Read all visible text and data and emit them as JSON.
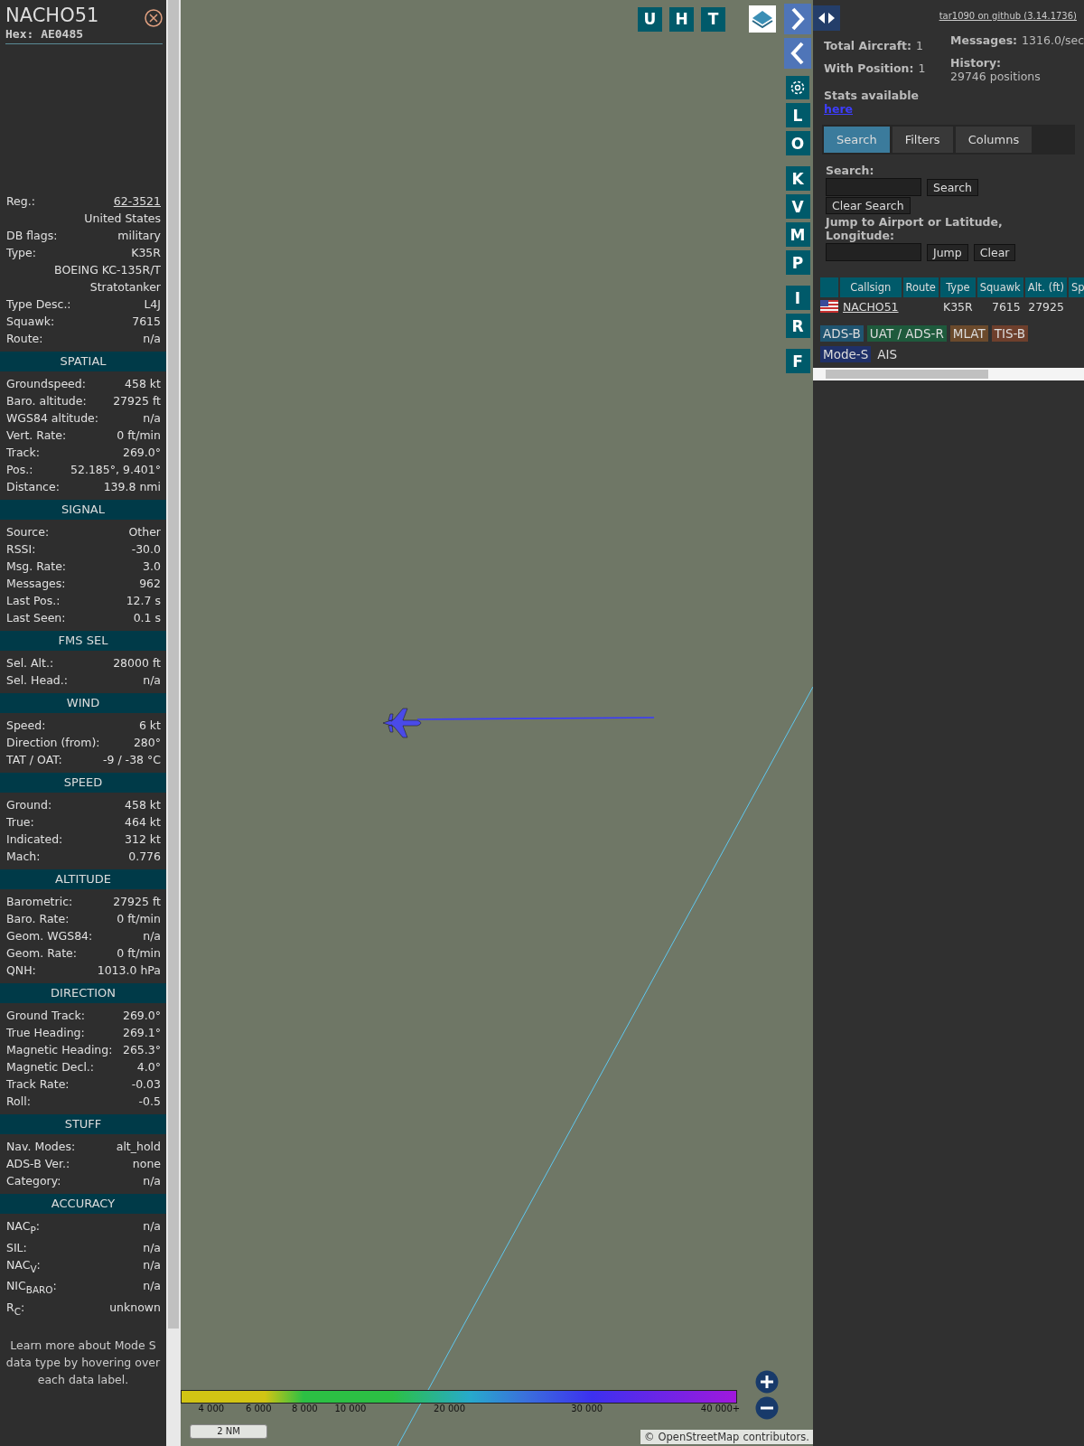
{
  "sidebar": {
    "title": "NACHO51",
    "hex": "Hex: AE0485",
    "info": [
      {
        "label": "Reg.:",
        "value": "62-3521",
        "link": true
      },
      {
        "value": "United States"
      },
      {
        "label": "DB flags:",
        "value": "military"
      },
      {
        "label": "Type:",
        "value": "K35R"
      },
      {
        "value": "BOEING KC-135R/T Stratotanker"
      },
      {
        "label": "Type Desc.:",
        "value": "L4J"
      },
      {
        "label": "Squawk:",
        "value": "7615"
      },
      {
        "label": "Route:",
        "value": "n/a"
      }
    ],
    "sections": [
      {
        "title": "SPATIAL",
        "rows": [
          {
            "label": "Groundspeed:",
            "value": "458 kt"
          },
          {
            "label": "Baro. altitude:",
            "value": "27925 ft"
          },
          {
            "label": "WGS84 altitude:",
            "value": "n/a"
          },
          {
            "label": "Vert. Rate:",
            "value": "0 ft/min"
          },
          {
            "label": "Track:",
            "value": "269.0°"
          },
          {
            "label": "Pos.:",
            "value": "52.185°, 9.401°"
          },
          {
            "label": "Distance:",
            "value": "139.8 nmi"
          }
        ]
      },
      {
        "title": "SIGNAL",
        "rows": [
          {
            "label": "Source:",
            "value": "Other"
          },
          {
            "label": "RSSI:",
            "value": "-30.0"
          },
          {
            "label": "Msg. Rate:",
            "value": "3.0"
          },
          {
            "label": "Messages:",
            "value": "962"
          },
          {
            "label": "Last Pos.:",
            "value": "12.7 s"
          },
          {
            "label": "Last Seen:",
            "value": "0.1 s"
          }
        ]
      },
      {
        "title": "FMS SEL",
        "rows": [
          {
            "label": "Sel. Alt.:",
            "value": "28000 ft"
          },
          {
            "label": "Sel. Head.:",
            "value": "n/a"
          }
        ]
      },
      {
        "title": "WIND",
        "rows": [
          {
            "label": "Speed:",
            "value": "6 kt"
          },
          {
            "label": "Direction (from):",
            "value": "280°"
          },
          {
            "label": "TAT / OAT:",
            "value": "-9 / -38 °C"
          }
        ]
      },
      {
        "title": "SPEED",
        "rows": [
          {
            "label": "Ground:",
            "value": "458 kt"
          },
          {
            "label": "True:",
            "value": "464 kt"
          },
          {
            "label": "Indicated:",
            "value": "312 kt"
          },
          {
            "label": "Mach:",
            "value": "0.776"
          }
        ]
      },
      {
        "title": "ALTITUDE",
        "rows": [
          {
            "label": "Barometric:",
            "value": "27925 ft"
          },
          {
            "label": "Baro. Rate:",
            "value": "0 ft/min"
          },
          {
            "label": "Geom. WGS84:",
            "value": "n/a"
          },
          {
            "label": "Geom. Rate:",
            "value": "0 ft/min"
          },
          {
            "label": "QNH:",
            "value": "1013.0 hPa"
          }
        ]
      },
      {
        "title": "DIRECTION",
        "rows": [
          {
            "label": "Ground Track:",
            "value": "269.0°"
          },
          {
            "label": "True Heading:",
            "value": "269.1°"
          },
          {
            "label": "Magnetic Heading:",
            "value": "265.3°"
          },
          {
            "label": "Magnetic Decl.:",
            "value": "4.0°"
          },
          {
            "label": "Track Rate:",
            "value": "-0.03"
          },
          {
            "label": "Roll:",
            "value": "-0.5"
          }
        ]
      },
      {
        "title": "STUFF",
        "rows": [
          {
            "label": "Nav. Modes:",
            "value": "alt_hold"
          },
          {
            "label": "ADS-B Ver.:",
            "value": "none"
          },
          {
            "label": "Category:",
            "value": "n/a"
          }
        ]
      },
      {
        "title": "ACCURACY",
        "rows": [
          {
            "label": "NAC$_{P}$:",
            "value": "n/a"
          },
          {
            "label": "SIL:",
            "value": "n/a"
          },
          {
            "label": "NAC$_{V}$:",
            "value": "n/a"
          },
          {
            "label": "NIC$_{BARO}$:",
            "value": "n/a"
          },
          {
            "label": "R$_{C}$:",
            "value": "unknown"
          }
        ]
      }
    ],
    "note": "Learn more about Mode S data type by hovering over each data label."
  },
  "map": {
    "top_buttons": [
      "U",
      "H",
      "T"
    ],
    "side_buttons": [
      {
        "kind": "arrow-right"
      },
      {
        "kind": "arrow-left"
      },
      {
        "kind": "gear"
      },
      {
        "kind": "letter",
        "label": "L"
      },
      {
        "kind": "letter",
        "label": "O"
      },
      {
        "kind": "letter",
        "label": "K"
      },
      {
        "kind": "letter",
        "label": "V"
      },
      {
        "kind": "letter",
        "label": "M"
      },
      {
        "kind": "letter",
        "label": "P"
      },
      {
        "kind": "letter",
        "label": "I"
      },
      {
        "kind": "letter",
        "label": "R"
      },
      {
        "kind": "letter",
        "label": "F"
      }
    ],
    "legend": [
      "4 000",
      "6 000",
      "8 000",
      "10 000",
      "20 000",
      "30 000",
      "40 000+"
    ],
    "scale": "2 NM",
    "attribution": {
      "prefix": "©",
      "link": "OpenStreetMap",
      "suffix": "contributors."
    }
  },
  "panel": {
    "github_link": "tar1090 on github (3.14.1736)",
    "stats": [
      {
        "label": "Total Aircraft:",
        "value": "1"
      },
      {
        "label": "Messages:",
        "value": "1316.0/sec"
      },
      {
        "label": "With Position:",
        "value": "1"
      },
      {
        "label": "History:",
        "value": "29746 positions"
      }
    ],
    "stats_note": "Stats available",
    "stats_link": "here",
    "tabs": [
      {
        "label": "Search",
        "selected": true
      },
      {
        "label": "Filters",
        "selected": false
      },
      {
        "label": "Columns",
        "selected": false
      }
    ],
    "search_label": "Search:",
    "search_button": "Search",
    "clear_search_button": "Clear Search",
    "jump_label": "Jump to Airport or Latitude, Longitude:",
    "jump_button": "Jump",
    "clear_button": "Clear",
    "table": {
      "columns": [
        "Callsign",
        "Route",
        "Type",
        "Squawk",
        "Alt. (ft)",
        "Sp"
      ],
      "rows": [
        {
          "callsign": "NACHO51",
          "type": "K35R",
          "squawk": "7615",
          "altitude": "27925"
        }
      ]
    },
    "sources": [
      {
        "label": "ADS-B",
        "color": "#1f5470"
      },
      {
        "label": "UAT / ADS-R",
        "color": "#1e5a3c"
      },
      {
        "label": "MLAT",
        "color": "#6b4a2c"
      },
      {
        "label": "TIS-B",
        "color": "#6e3f2c"
      },
      {
        "label": "Mode-S",
        "color": "#1f3068"
      },
      {
        "label": "AIS"
      }
    ]
  }
}
